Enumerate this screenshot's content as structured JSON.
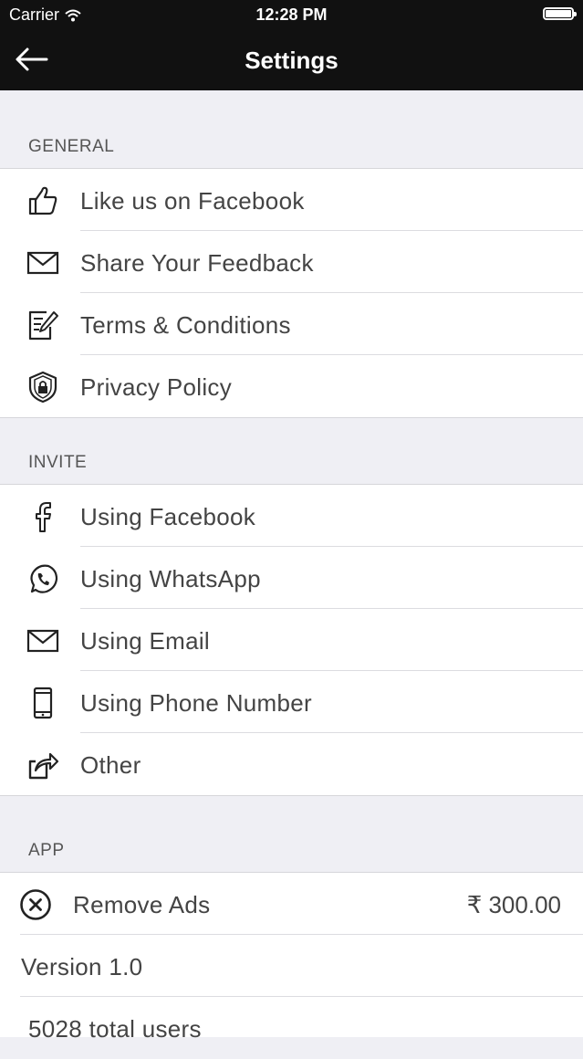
{
  "status_bar": {
    "carrier": "Carrier",
    "time": "12:28 PM"
  },
  "navbar": {
    "title": "Settings",
    "back_icon": "arrow-left-icon"
  },
  "sections": {
    "general": {
      "header": "GENERAL",
      "items": [
        {
          "label": "Like us on Facebook",
          "icon": "thumbs-up-icon"
        },
        {
          "label": "Share Your Feedback",
          "icon": "envelope-icon"
        },
        {
          "label": "Terms & Conditions",
          "icon": "document-edit-icon"
        },
        {
          "label": "Privacy Policy",
          "icon": "shield-lock-icon"
        }
      ]
    },
    "invite": {
      "header": "INVITE",
      "items": [
        {
          "label": "Using Facebook",
          "icon": "facebook-icon"
        },
        {
          "label": "Using WhatsApp",
          "icon": "whatsapp-icon"
        },
        {
          "label": "Using Email",
          "icon": "envelope-icon"
        },
        {
          "label": "Using Phone Number",
          "icon": "phone-icon"
        },
        {
          "label": "Other",
          "icon": "share-icon"
        }
      ]
    },
    "app": {
      "header": "APP",
      "remove_ads": {
        "label": "Remove Ads",
        "price": "₹ 300.00",
        "icon": "close-circle-icon"
      },
      "version": "Version 1.0",
      "total_users": "5028 total users"
    }
  }
}
